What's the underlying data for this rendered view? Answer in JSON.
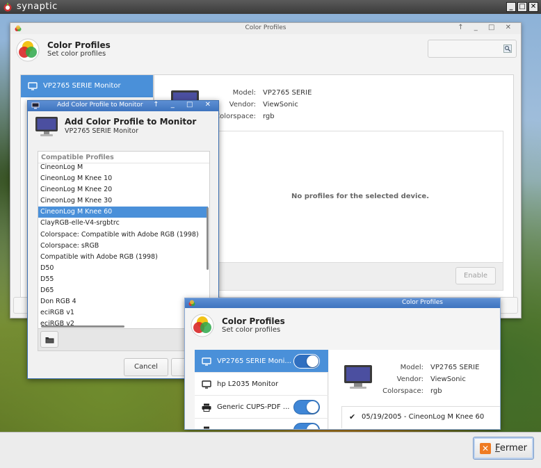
{
  "outer": {
    "title": "synaptic",
    "close_label": "Fermer",
    "close_mnemonic": "F",
    "close_rest": "ermer"
  },
  "wm": {
    "minimize": "_",
    "restore": "□",
    "close": "✕"
  },
  "colorProfiles": {
    "window_title": "Color Profiles",
    "header_title": "Color Profiles",
    "header_subtitle": "Set color profiles",
    "selected_device": "VP2765 SERIE Monitor",
    "model_label": "Model:",
    "model_value": "VP2765 SERIE",
    "vendor_label": "Vendor:",
    "vendor_value": "ViewSonic",
    "colorspace_label": "Colorspace:",
    "colorspace_value": "rgb",
    "empty_message": "No profiles for the selected device.",
    "enable_label": "Enable"
  },
  "addDialog": {
    "title": "Add Color Profile to Monitor",
    "header_title": "Add Color Profile to Monitor",
    "header_subtitle": "VP2765 SERIE Monitor",
    "list_header": "Compatible Profiles",
    "profiles": [
      "CineonLog M",
      "CineonLog M Knee 10",
      "CineonLog M Knee 20",
      "CineonLog M Knee 30",
      "CineonLog M Knee 60",
      "ClayRGB-elle-V4-srgbtrc",
      "Colorspace: Compatible with Adobe RGB (1998)",
      "Colorspace: sRGB",
      "Compatible with Adobe RGB (1998)",
      "D50",
      "D55",
      "D65",
      "Don RGB 4",
      "eciRGB v1",
      "eciRGB v2"
    ],
    "selected_index": 4,
    "cancel_label": "Cancel"
  },
  "front": {
    "window_title": "Color Profiles",
    "header_title": "Color Profiles",
    "header_subtitle": "Set color profiles",
    "devices": [
      {
        "label": "VP2765 SERIE Moni...",
        "icon": "monitor-icon",
        "toggle": true
      },
      {
        "label": "hp L2035 Monitor",
        "icon": "monitor-icon",
        "toggle": false
      },
      {
        "label": "Generic CUPS-PDF ...",
        "icon": "printer-icon",
        "toggle": true
      },
      {
        "label": "",
        "icon": "printer-icon",
        "toggle": true
      }
    ],
    "model_label": "Model:",
    "model_value": "VP2765 SERIE",
    "vendor_label": "Vendor:",
    "vendor_value": "ViewSonic",
    "colorspace_label": "Colorspace:",
    "colorspace_value": "rgb",
    "profile_entry": "05/19/2005 - CineonLog M Knee 60"
  },
  "colors": {
    "accent": "#4a90d9",
    "titlebar_active": "#3e74bf",
    "fermer_icon": "#ef7b22"
  }
}
